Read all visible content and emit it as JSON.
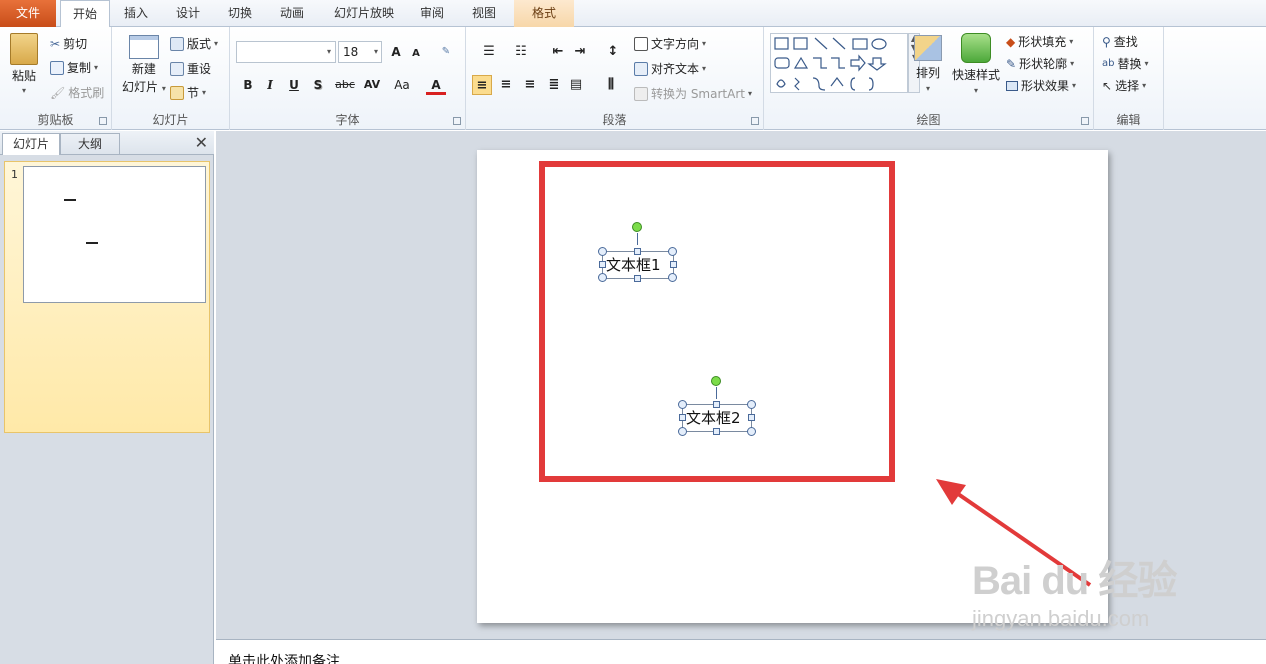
{
  "tabs": [
    {
      "label": "文件"
    },
    {
      "label": "开始"
    },
    {
      "label": "插入"
    },
    {
      "label": "设计"
    },
    {
      "label": "切换"
    },
    {
      "label": "动画"
    },
    {
      "label": "幻灯片放映"
    },
    {
      "label": "审阅"
    },
    {
      "label": "视图"
    },
    {
      "label": "格式"
    }
  ],
  "ribbon": {
    "clipboard": {
      "paste": "粘贴",
      "cut": "剪切",
      "copy": "复制",
      "format_painter": "格式刷",
      "label": "剪贴板"
    },
    "slides": {
      "new_slide_1": "新建",
      "new_slide_2": "幻灯片",
      "layout": "版式",
      "reset": "重设",
      "section": "节",
      "label": "幻灯片"
    },
    "font": {
      "font_name": "",
      "font_size": "18",
      "label": "字体",
      "bold": "B",
      "italic": "I",
      "underline": "U",
      "shadow": "S",
      "strike": "abc",
      "spacing": "AV",
      "case": "Aa",
      "color": "A",
      "grow": "A",
      "shrink": "A"
    },
    "paragraph": {
      "text_direction": "文字方向",
      "align_text": "对齐文本",
      "smartart": "转换为 SmartArt",
      "label": "段落"
    },
    "drawing": {
      "arrange": "排列",
      "quick_styles": "快速样式",
      "fill": "形状填充",
      "outline": "形状轮廓",
      "effects": "形状效果",
      "label": "绘图"
    },
    "editing": {
      "find": "查找",
      "replace": "替换",
      "select": "选择",
      "label": "编辑"
    }
  },
  "left_panel": {
    "tab_slides": "幻灯片",
    "tab_outline": "大纲",
    "close": "✕",
    "slide_number": "1"
  },
  "slide": {
    "textbox1": "文本框1",
    "textbox2": "文本框2"
  },
  "notes": {
    "placeholder": "单击此处添加备注"
  },
  "watermark": {
    "brand": "Bai du 经验",
    "url": "jingyan.baidu.com"
  },
  "colors": {
    "accent_red": "#e23a3a",
    "file_tab": "#c84d19",
    "rotate_handle": "#7cdc4a"
  }
}
